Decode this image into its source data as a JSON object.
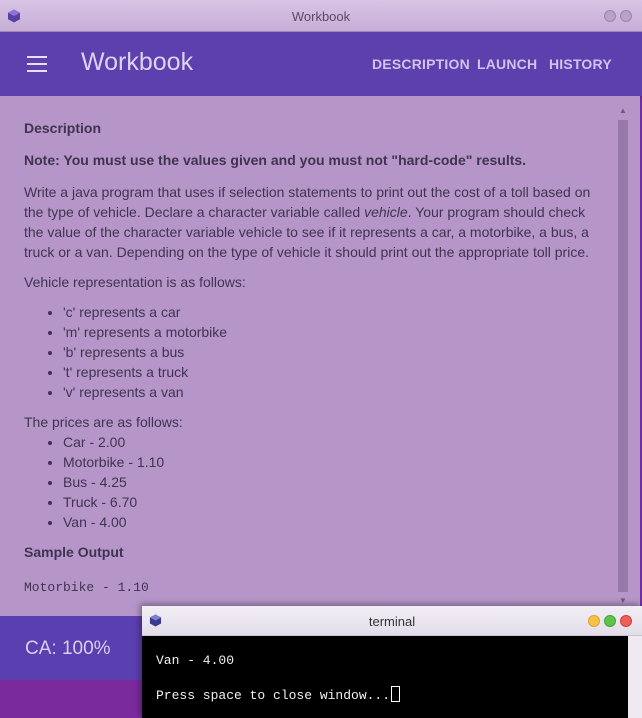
{
  "window": {
    "title": "Workbook"
  },
  "appbar": {
    "brand": "Workbook",
    "nav": [
      "DESCRIPTION",
      "LAUNCH",
      "HISTORY"
    ]
  },
  "content": {
    "heading": "Description",
    "note": "Note: You must use the values given and you must not \"hard-code\" results.",
    "intro_before": "Write a java program that uses if selection statements to print out the cost of a toll based on the type of vehicle. Declare a character variable called ",
    "intro_italic": "vehicle",
    "intro_after": ". Your program should check the value of the character variable vehicle to see if it represents a car, a motorbike, a bus, a truck or a van. Depending on the type of vehicle it should print out the appropriate toll price.",
    "representation_label": "Vehicle representation is as follows:",
    "representations": [
      "'c' represents a car",
      "'m' represents a motorbike",
      "'b' represents a bus",
      "'t' represents a truck",
      "'v' represents a van"
    ],
    "prices_label": "The prices are as follows:",
    "prices": [
      "Car - 2.00",
      "Motorbike - 1.10",
      "Bus - 4.25",
      "Truck - 6.70",
      "Van - 4.00"
    ],
    "sample_heading": "Sample Output",
    "sample_output": "Motorbike - 1.10"
  },
  "footer": {
    "ca": "CA: 100%"
  },
  "terminal": {
    "title": "terminal",
    "lines": [
      "Van - 4.00",
      "Press space to close window..."
    ]
  },
  "colors": {
    "appbar": "#5e3fae",
    "content_bg": "#b696c8",
    "terminal_bg": "#000000",
    "traffic_yellow": "#f6c244",
    "traffic_green": "#5fc34a",
    "traffic_red": "#ef5f57"
  }
}
